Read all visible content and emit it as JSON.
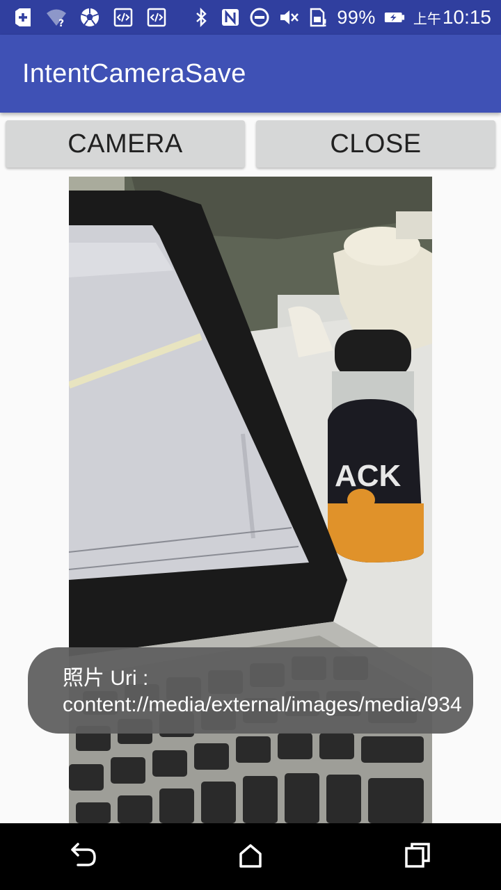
{
  "status_bar": {
    "icons_left": [
      "add-box-icon",
      "wifi-unknown-icon",
      "soccer-ball-icon",
      "code-notification-icon",
      "code-notification-icon"
    ],
    "icons_right": [
      "bluetooth-icon",
      "nfc-icon",
      "do-not-disturb-icon",
      "mute-icon",
      "sim-alert-icon",
      "battery-charging-icon"
    ],
    "battery_percent": "99%",
    "time_period": "上午",
    "time": "10:15"
  },
  "app_bar": {
    "title": "IntentCameraSave"
  },
  "buttons": {
    "camera_label": "CAMERA",
    "close_label": "CLOSE"
  },
  "toast": {
    "message": "照片 Uri : content://media/external/images/media/934"
  },
  "navigation": {
    "icons": [
      "back-icon",
      "home-icon",
      "recents-icon"
    ]
  }
}
